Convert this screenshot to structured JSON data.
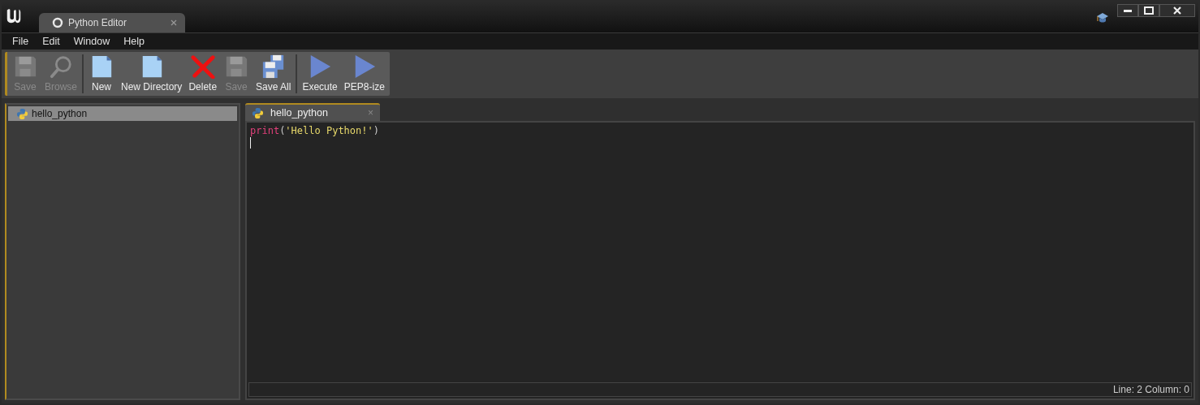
{
  "window": {
    "tab_title": "Python Editor"
  },
  "menu": [
    "File",
    "Edit",
    "Window",
    "Help"
  ],
  "toolbar": [
    {
      "buttons": [
        {
          "label": "Save",
          "kind": "save",
          "disabled": true
        },
        {
          "label": "Browse",
          "kind": "browse",
          "disabled": true
        }
      ]
    },
    {
      "buttons": [
        {
          "label": "New",
          "kind": "new",
          "disabled": false
        },
        {
          "label": "New Directory",
          "kind": "new",
          "disabled": false
        },
        {
          "label": "Delete",
          "kind": "delete",
          "disabled": false
        },
        {
          "label": "Save",
          "kind": "save",
          "disabled": true
        },
        {
          "label": "Save All",
          "kind": "saveall",
          "disabled": false
        }
      ]
    },
    {
      "buttons": [
        {
          "label": "Execute",
          "kind": "run",
          "disabled": false
        },
        {
          "label": "PEP8-ize",
          "kind": "run",
          "disabled": false
        }
      ]
    }
  ],
  "files": [
    {
      "name": "hello_python",
      "selected": true
    }
  ],
  "editor_tabs": [
    {
      "label": "hello_python",
      "close": "×",
      "selected": true
    }
  ],
  "code_lines": [
    {
      "cursor": false,
      "tokens": [
        {
          "text": "print",
          "kind": "keyword"
        },
        {
          "text": "(",
          "kind": "punct"
        },
        {
          "text": "'Hello Python!'",
          "kind": "string"
        },
        {
          "text": ")",
          "kind": "punct"
        }
      ]
    },
    {
      "cursor": true
    }
  ],
  "status": "Line: 2 Column: 0"
}
